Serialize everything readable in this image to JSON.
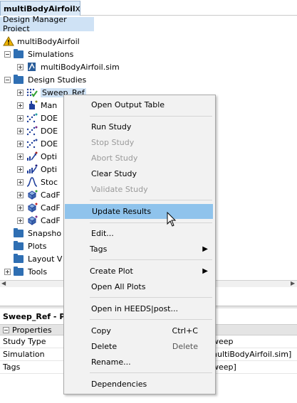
{
  "tab": {
    "title": "multiBodyAirfoil",
    "close": "x"
  },
  "subtab": {
    "label": "Design Manager Project"
  },
  "tree": {
    "root": "multiBodyAirfoil",
    "simulations": "Simulations",
    "sim_file": "multiBodyAirfoil.sim",
    "design_studies": "Design Studies",
    "studies": [
      "Sweep_Ref",
      "Man",
      "DOE",
      "DOE",
      "DOE",
      "Opti",
      "Opti",
      "Stoc",
      "CadF",
      "CadF",
      "CadF"
    ],
    "snapshots": "Snapsho",
    "plots": "Plots",
    "layout_views": "Layout V",
    "tools": "Tools"
  },
  "properties": {
    "title": "Sweep_Ref - Pr",
    "header": "Properties",
    "rows": [
      {
        "key": "Study Type",
        "value": "weep"
      },
      {
        "key": "Simulation",
        "value": "nultiBodyAirfoil.sim]"
      },
      {
        "key": "Tags",
        "value": "weep]"
      }
    ]
  },
  "menu": {
    "open_output_table": "Open Output Table",
    "run_study": "Run Study",
    "stop_study": "Stop Study",
    "abort_study": "Abort Study",
    "clear_study": "Clear Study",
    "validate_study": "Validate Study",
    "update_results": "Update Results",
    "edit": "Edit...",
    "tags": "Tags",
    "create_plot": "Create Plot",
    "open_all_plots": "Open All Plots",
    "open_heeds": "Open in HEEDS|post...",
    "copy": "Copy",
    "copy_shortcut": "Ctrl+C",
    "delete": "Delete",
    "delete_shortcut": "Delete",
    "rename": "Rename...",
    "dependencies": "Dependencies"
  },
  "colors": {
    "selection": "#cfe2f5",
    "menu_hover": "#8fc3ec",
    "folder": "#2f6fb3"
  }
}
